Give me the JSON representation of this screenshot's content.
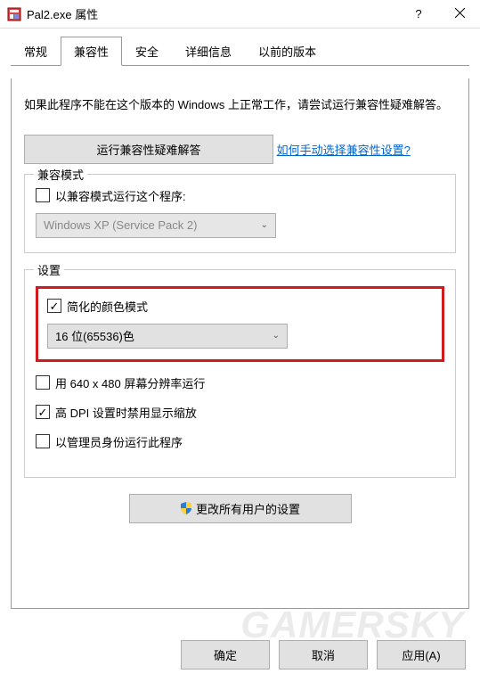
{
  "titlebar": {
    "title": "Pal2.exe 属性"
  },
  "tabs": {
    "items": [
      {
        "label": "常规"
      },
      {
        "label": "兼容性"
      },
      {
        "label": "安全"
      },
      {
        "label": "详细信息"
      },
      {
        "label": "以前的版本"
      }
    ],
    "activeIndex": 1
  },
  "body": {
    "description": "如果此程序不能在这个版本的 Windows 上正常工作，请尝试运行兼容性疑难解答。",
    "troubleshoot_btn": "运行兼容性疑难解答",
    "manual_link": "如何手动选择兼容性设置?",
    "compat_mode": {
      "legend": "兼容模式",
      "checkbox_label": "以兼容模式运行这个程序:",
      "select_value": "Windows XP (Service Pack 2)"
    },
    "settings": {
      "legend": "设置",
      "reduced_color_label": "简化的颜色模式",
      "color_select_value": "16 位(65536)色",
      "run640_label": "用 640 x 480 屏幕分辨率运行",
      "highdpi_label": "高 DPI 设置时禁用显示缩放",
      "admin_label": "以管理员身份运行此程序"
    },
    "all_users_btn": "更改所有用户的设置"
  },
  "footer": {
    "ok": "确定",
    "cancel": "取消",
    "apply": "应用(A)"
  },
  "watermark": "GAMERSKY"
}
